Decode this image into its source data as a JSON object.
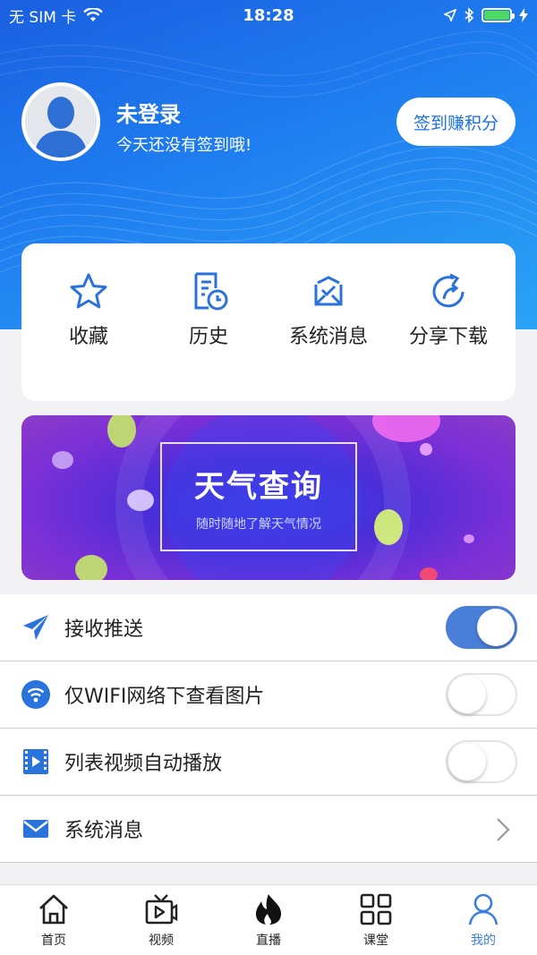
{
  "status_bar": {
    "carrier": "无 SIM 卡",
    "time": "18:28"
  },
  "profile": {
    "username": "未登录",
    "hint": "今天还没有签到哦!",
    "signin_button": "签到赚积分"
  },
  "quick_actions": [
    {
      "label": "收藏",
      "icon": "star-icon"
    },
    {
      "label": "历史",
      "icon": "history-icon"
    },
    {
      "label": "系统消息",
      "icon": "message-icon"
    },
    {
      "label": "分享下载",
      "icon": "share-icon"
    }
  ],
  "banner": {
    "title": "天气查询",
    "subtitle": "随时随地了解天气情况"
  },
  "settings": [
    {
      "label": "接收推送",
      "icon": "paper-plane-icon",
      "control": "toggle",
      "on": true
    },
    {
      "label": "仅WIFI网络下查看图片",
      "icon": "wifi-icon",
      "control": "toggle",
      "on": false
    },
    {
      "label": "列表视频自动播放",
      "icon": "video-icon",
      "control": "toggle",
      "on": false
    },
    {
      "label": "系统消息",
      "icon": "mail-icon",
      "control": "chevron"
    }
  ],
  "tabs": [
    {
      "label": "首页",
      "icon": "home-icon",
      "active": false
    },
    {
      "label": "视频",
      "icon": "tv-icon",
      "active": false
    },
    {
      "label": "直播",
      "icon": "flame-icon",
      "active": false
    },
    {
      "label": "课堂",
      "icon": "grid-icon",
      "active": false
    },
    {
      "label": "我的",
      "icon": "person-icon",
      "active": true
    }
  ],
  "colors": {
    "accent": "#1a6fe3",
    "tab_active": "#3a7fe0",
    "toggle_on": "#4a7fd9"
  }
}
